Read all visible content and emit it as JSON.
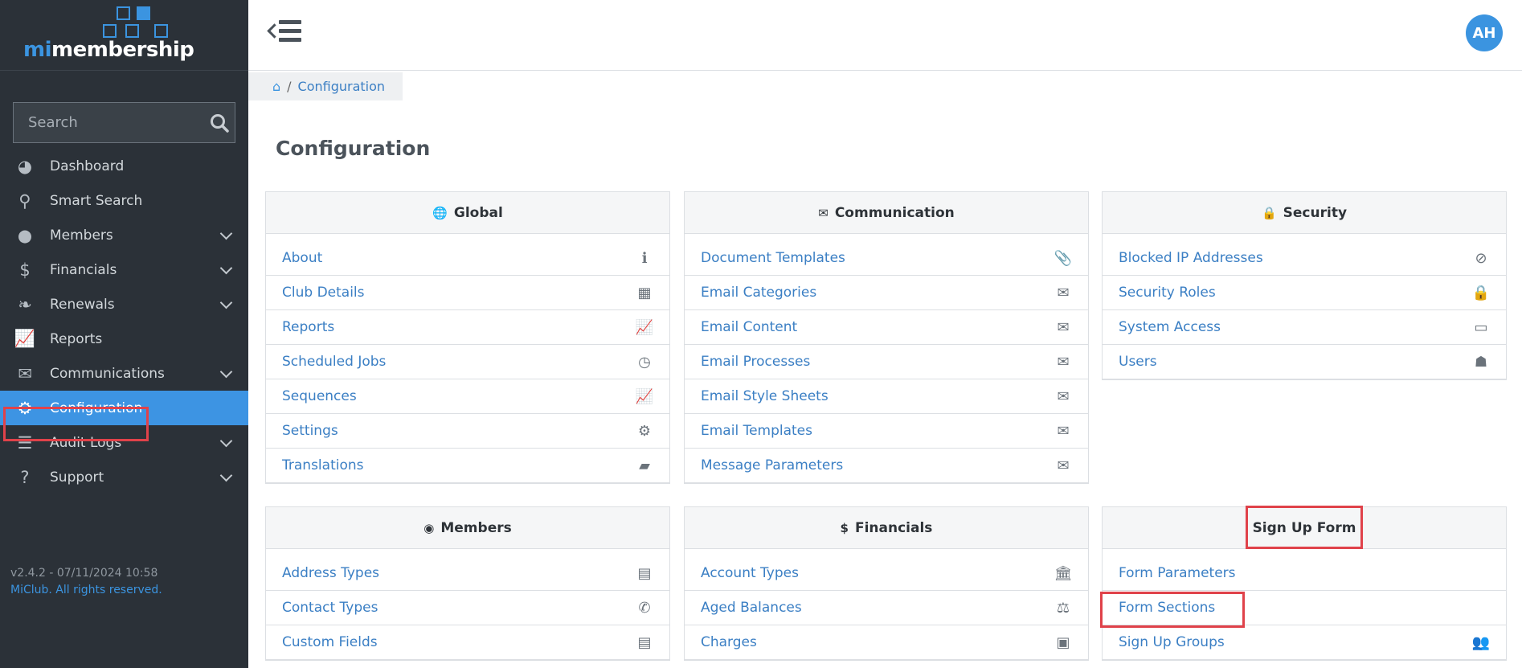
{
  "logo": {
    "mi": "mi",
    "rest": "membership"
  },
  "sidebar": {
    "search_placeholder": "Search",
    "items": [
      {
        "label": "Dashboard",
        "icon": "dashboard-icon",
        "glyph": "◕",
        "chevron": false
      },
      {
        "label": "Smart Search",
        "icon": "search-icon",
        "glyph": "⚲",
        "chevron": false
      },
      {
        "label": "Members",
        "icon": "user-circle-icon",
        "glyph": "●",
        "chevron": true
      },
      {
        "label": "Financials",
        "icon": "dollar-icon",
        "glyph": "$",
        "chevron": true
      },
      {
        "label": "Renewals",
        "icon": "leaf-icon",
        "glyph": "❧",
        "chevron": true
      },
      {
        "label": "Reports",
        "icon": "line-chart-icon",
        "glyph": "📈",
        "chevron": false
      },
      {
        "label": "Communications",
        "icon": "envelope-icon",
        "glyph": "✉",
        "chevron": true
      },
      {
        "label": "Configuration",
        "icon": "gear-icon",
        "glyph": "⚙",
        "chevron": false
      },
      {
        "label": "Audit Logs",
        "icon": "list-icon",
        "glyph": "☰",
        "chevron": true
      },
      {
        "label": "Support",
        "icon": "question-circle-icon",
        "glyph": "?",
        "chevron": true
      }
    ],
    "active_index": 7,
    "version": "v2.4.2 - 07/11/2024 10:58",
    "copyright": "MiClub. All rights reserved."
  },
  "topbar": {
    "avatar_initials": "AH"
  },
  "breadcrumb": {
    "current": "Configuration"
  },
  "page_title": "Configuration",
  "panels": [
    {
      "title": "Global",
      "icon": "globe-icon",
      "glyph": "🌐",
      "items": [
        {
          "label": "About",
          "icon": "info-icon",
          "glyph": "ℹ"
        },
        {
          "label": "Club Details",
          "icon": "building-icon",
          "glyph": "▦"
        },
        {
          "label": "Reports",
          "icon": "line-chart-icon",
          "glyph": "📈"
        },
        {
          "label": "Scheduled Jobs",
          "icon": "clock-icon",
          "glyph": "◷"
        },
        {
          "label": "Sequences",
          "icon": "line-chart-icon",
          "glyph": "📈"
        },
        {
          "label": "Settings",
          "icon": "gear-icon",
          "glyph": "⚙"
        },
        {
          "label": "Translations",
          "icon": "book-icon",
          "glyph": "▰"
        }
      ]
    },
    {
      "title": "Communication",
      "icon": "envelope-icon",
      "glyph": "✉",
      "items": [
        {
          "label": "Document Templates",
          "icon": "paperclip-icon",
          "glyph": "📎"
        },
        {
          "label": "Email Categories",
          "icon": "envelope-icon",
          "glyph": "✉"
        },
        {
          "label": "Email Content",
          "icon": "envelope-icon",
          "glyph": "✉"
        },
        {
          "label": "Email Processes",
          "icon": "envelope-icon",
          "glyph": "✉"
        },
        {
          "label": "Email Style Sheets",
          "icon": "envelope-icon",
          "glyph": "✉"
        },
        {
          "label": "Email Templates",
          "icon": "envelope-icon",
          "glyph": "✉"
        },
        {
          "label": "Message Parameters",
          "icon": "envelope-icon",
          "glyph": "✉"
        }
      ]
    },
    {
      "title": "Security",
      "icon": "lock-icon",
      "glyph": "🔒",
      "items": [
        {
          "label": "Blocked IP Addresses",
          "icon": "ban-icon",
          "glyph": "⊘"
        },
        {
          "label": "Security Roles",
          "icon": "lock-icon",
          "glyph": "🔒"
        },
        {
          "label": "System Access",
          "icon": "desktop-icon",
          "glyph": "▭"
        },
        {
          "label": "Users",
          "icon": "user-secret-icon",
          "glyph": "☗"
        }
      ]
    },
    {
      "title": "Members",
      "icon": "user-circle-icon",
      "glyph": "◉",
      "items": [
        {
          "label": "Address Types",
          "icon": "address-card-icon",
          "glyph": "▤"
        },
        {
          "label": "Contact Types",
          "icon": "phone-icon",
          "glyph": "✆"
        },
        {
          "label": "Custom Fields",
          "icon": "id-card-icon",
          "glyph": "▤"
        }
      ]
    },
    {
      "title": "Financials",
      "icon": "dollar-icon",
      "glyph": "$",
      "items": [
        {
          "label": "Account Types",
          "icon": "bank-icon",
          "glyph": "🏛"
        },
        {
          "label": "Aged Balances",
          "icon": "balance-scale-icon",
          "glyph": "⚖"
        },
        {
          "label": "Charges",
          "icon": "money-icon",
          "glyph": "▣"
        }
      ]
    },
    {
      "title": "Sign Up Form",
      "icon": "",
      "glyph": "",
      "items": [
        {
          "label": "Form Parameters",
          "icon": "",
          "glyph": ""
        },
        {
          "label": "Form Sections",
          "icon": "",
          "glyph": ""
        },
        {
          "label": "Sign Up Groups",
          "icon": "users-icon",
          "glyph": "👥"
        }
      ]
    }
  ],
  "colors": {
    "accent": "#3b94e0",
    "sidebar_bg": "#2b3138",
    "highlight": "#e0424a",
    "link": "#3b7fc4"
  }
}
